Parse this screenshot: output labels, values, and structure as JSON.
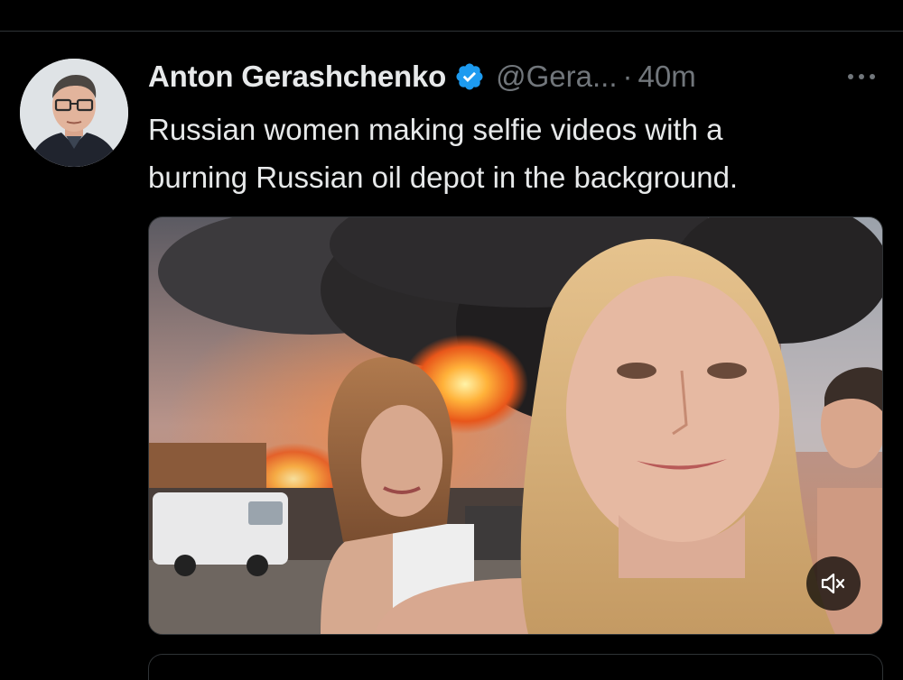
{
  "tweet": {
    "author": {
      "name": "Anton Gerashchenko",
      "handle": "@Gera...",
      "verified": true
    },
    "separator": "·",
    "timestamp": "40m",
    "text_lines": [
      "Russian women making selfie videos with a",
      "burning Russian oil depot in the background."
    ],
    "media": {
      "type": "video",
      "muted": true
    }
  },
  "colors": {
    "background": "#000000",
    "text_primary": "#e7e9ea",
    "text_secondary": "#71767b",
    "verified_badge": "#1d9bf0",
    "divider": "#2f3336"
  },
  "icons": {
    "verified": "verified-badge-icon",
    "more": "more-horizontal-icon",
    "mute": "volume-muted-icon"
  }
}
